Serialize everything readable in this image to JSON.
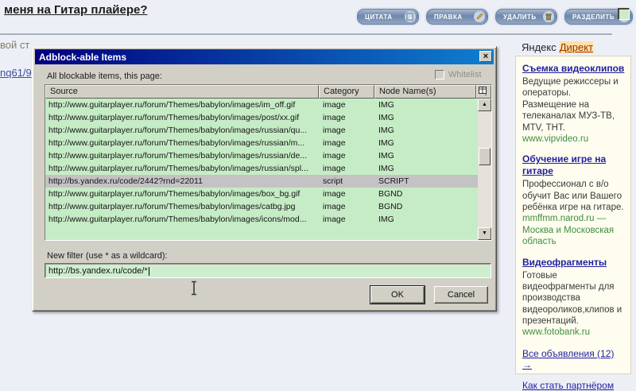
{
  "page": {
    "topic_title": "меня на Гитар плайере?",
    "fragment_text": "вой ст",
    "fragment_link": "nq61/9",
    "toolbar": {
      "quote_label": "ЦИТАТА",
      "edit_label": "ПРАВКА",
      "delete_label": "УДАЛИТЬ",
      "split_label": "РАЗДЕЛИТЬ"
    }
  },
  "dialog": {
    "title": "Adblock-able Items",
    "items_label": "All blockable items, this page:",
    "whitelist_label": "Whitelist",
    "table": {
      "headers": [
        "Source",
        "Category",
        "Node Name(s)"
      ],
      "rows": [
        {
          "source": "http://www.guitarplayer.ru/forum/Themes/babylon/images/im_off.gif",
          "category": "image",
          "node": "IMG",
          "selected": false
        },
        {
          "source": "http://www.guitarplayer.ru/forum/Themes/babylon/images/post/xx.gif",
          "category": "image",
          "node": "IMG",
          "selected": false
        },
        {
          "source": "http://www.guitarplayer.ru/forum/Themes/babylon/images/russian/qu...",
          "category": "image",
          "node": "IMG",
          "selected": false
        },
        {
          "source": "http://www.guitarplayer.ru/forum/Themes/babylon/images/russian/m...",
          "category": "image",
          "node": "IMG",
          "selected": false
        },
        {
          "source": "http://www.guitarplayer.ru/forum/Themes/babylon/images/russian/de...",
          "category": "image",
          "node": "IMG",
          "selected": false
        },
        {
          "source": "http://www.guitarplayer.ru/forum/Themes/babylon/images/russian/spl...",
          "category": "image",
          "node": "IMG",
          "selected": false
        },
        {
          "source": "http://bs.yandex.ru/code/2442?rnd=22011",
          "category": "script",
          "node": "SCRIPT",
          "selected": true
        },
        {
          "source": "http://www.guitarplayer.ru/forum/Themes/babylon/images/box_bg.gif",
          "category": "image",
          "node": "BGND",
          "selected": false
        },
        {
          "source": "http://www.guitarplayer.ru/forum/Themes/babylon/images/catbg.jpg",
          "category": "image",
          "node": "BGND",
          "selected": false
        },
        {
          "source": "http://www.guitarplayer.ru/forum/Themes/babylon/images/icons/mod...",
          "category": "image",
          "node": "IMG",
          "selected": false
        }
      ]
    },
    "filter_label": "New filter (use * as a wildcard):",
    "filter_value": "http://bs.yandex.ru/code/*",
    "ok_label": "OK",
    "cancel_label": "Cancel"
  },
  "sidebar": {
    "brand": "Яндекс",
    "direct_link": "Директ",
    "ads": [
      {
        "title": "Съемка видеоклипов",
        "body": "Ведущие режиссеры и операторы. Размещение на телеканалах МУЗ-ТВ, MTV, ТНТ.",
        "url_line": "www.vipvideo.ru"
      },
      {
        "title": "Обучение игре на гитаре",
        "body": "Профессионал с в/о обучит Вас или Вашего ребёнка игре на гитаре.",
        "url_line": "mmffmm.narod.ru — Москва и Московская область"
      },
      {
        "title": "Видеофрагменты",
        "body": "Готовые видеофрагменты для производства видеороликов,клипов и презентаций.",
        "url_line": "www.fotobank.ru"
      }
    ],
    "all_ads_link": "Все объявления (12) →",
    "partner_link": "Как стать партнёром"
  },
  "icons": {
    "close": "×",
    "scroll_up": "▲",
    "scroll_down": "▼"
  },
  "colors": {
    "titlebar_start": "#00007e",
    "titlebar_end": "#0f7fd0",
    "table_green": "#c6ecc6",
    "selected_row": "#c3c3c3",
    "dialog_gray": "#d2cfc7",
    "ad_bg": "#fffdf0",
    "link_blue": "#1f1f9e",
    "url_green": "#3e8e3e",
    "direct_red": "#993300",
    "direct_highlight": "#ffe0a8"
  }
}
